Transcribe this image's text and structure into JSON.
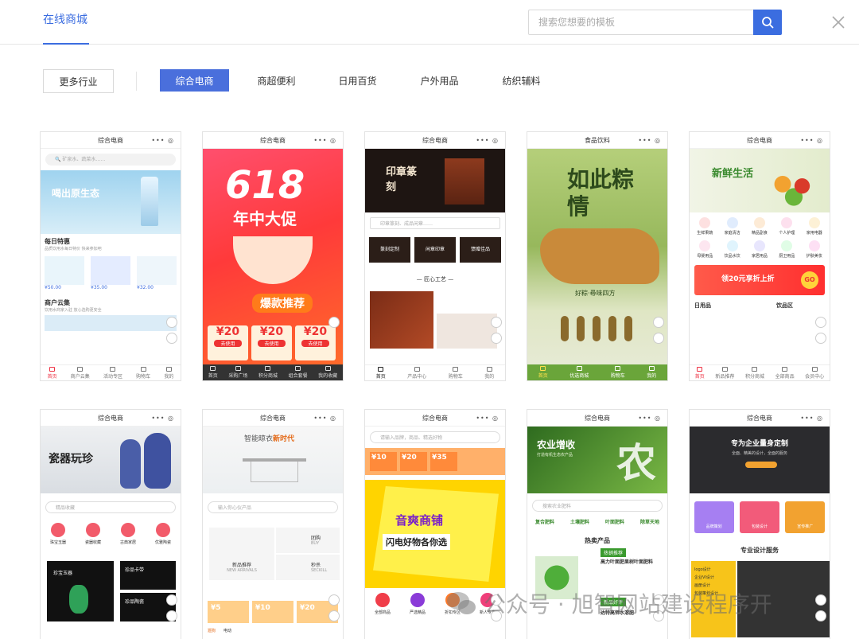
{
  "header": {
    "tab_label": "在线商城",
    "search_placeholder": "搜索您想要的模板"
  },
  "filters": {
    "more_label": "更多行业",
    "categories": [
      {
        "label": "综合电商",
        "active": true
      },
      {
        "label": "商超便利"
      },
      {
        "label": "日用百货"
      },
      {
        "label": "户外用品"
      },
      {
        "label": "纺织辅料"
      }
    ]
  },
  "templates": [
    {
      "title": "综合电商",
      "search": "矿泉水、蔬菜水……",
      "banner": "喝出原生态",
      "section1": "每日特惠",
      "section1_sub": "品质饮用水每日特价 快来参加吧",
      "prices": [
        "¥50.00",
        "¥35.00",
        "¥32.00"
      ],
      "section2": "商户云集",
      "section2_sub": "饮用水商家入驻 放心选购更安全",
      "tabs": [
        "首页",
        "商户云集",
        "活动专区",
        "购物车",
        "我的"
      ]
    },
    {
      "title": "综合电商",
      "banner_big": "618",
      "banner_sub": "年中大促",
      "banner_promo": "爆款推荐",
      "coupon_value": "20",
      "coupon_btn": "去使用",
      "tabs": [
        "首页",
        "采购广场",
        "积分商城",
        "组合套餐",
        "我的收藏"
      ]
    },
    {
      "title": "综合电商",
      "banner": "印章篆刻",
      "search": "印章篆刻、成品闲章……",
      "cats": [
        "篆刻定制",
        "闲章印章",
        "馈赠佳品"
      ],
      "section": "匠心工艺",
      "tabs": [
        "首页",
        "产品中心",
        "购物车",
        "我的"
      ]
    },
    {
      "title": "食品饮料",
      "banner": "如此粽情",
      "tagline": "好粽·尋味四方",
      "tabs": [
        "首页",
        "优选商城",
        "购物车",
        "我的"
      ]
    },
    {
      "title": "综合电商",
      "banner": "新鲜生活",
      "icons1": [
        "生鲜果蔬",
        "家庭清洁",
        "精品副食",
        "个人护理",
        "家用电器"
      ],
      "icons2": [
        "母婴用品",
        "饮品水饮",
        "家居用品",
        "厨卫用品",
        "护肤美妆"
      ],
      "coupon": "领20元享折上折",
      "section1": "日用品",
      "section2": "饮品区",
      "tabs": [
        "首页",
        "新品推荐",
        "积分商城",
        "全部商品",
        "会员中心"
      ]
    },
    {
      "title": "综合电商",
      "banner": "瓷器玩珍",
      "search": "精品收藏",
      "cats": [
        "珠宝玉器",
        "瓷器收藏",
        "古典家居",
        "优雅陶瓷"
      ],
      "product": "珍宝玉器",
      "product2": "珍品卡带",
      "product3": "珍品陶瓷"
    },
    {
      "title": "综合电商",
      "banner_pre": "智能晾衣",
      "banner_hl": "新时代",
      "search": "输入你心仪产品",
      "label1": "新品推荐",
      "label1_sub": "NEW ARRIVALS",
      "label2": "团购",
      "label2_sub": "BUY",
      "label3": "秒杀",
      "label3_sub": "SECKILL",
      "coupon_values": [
        "5",
        "10",
        "20"
      ],
      "tabs": [
        "遛狗",
        "电动"
      ]
    },
    {
      "title": "综合电商",
      "search": "请输入品牌，商品、精选好物",
      "coupon_values": [
        "10",
        "20",
        "35"
      ],
      "banner": "音爽商铺",
      "banner_sub": "闪电好物各你选",
      "icons": [
        "全部商品",
        "严选精品",
        "折扣专区",
        "新人专享"
      ]
    },
    {
      "title": "综合电商",
      "banner": "农业增收",
      "banner_sub": "打造有机生态农产品",
      "big_char": "农",
      "search": "搜索农业肥料",
      "cats": [
        "复合肥料",
        "土壤肥料",
        "叶面肥料",
        "除草天地"
      ],
      "section": "热卖产品",
      "tag": "热销推荐",
      "product": "高力叶面肥果树叶面肥料",
      "tag2": "新品好评",
      "product2": "达特高钾水溶肥"
    },
    {
      "title": "综合电商",
      "banner": "专为企业量身定制",
      "banner_sub": "全面、精美的设计，全面的服务",
      "cats": [
        "品牌策划",
        "包装设计",
        "宣传推广"
      ],
      "section": "专业设计服务",
      "list": [
        "logo设计",
        "企业VI设计",
        "画册设计",
        "包装策划设计"
      ]
    }
  ],
  "watermark": {
    "text": "公众号 · 旭智网站建设程序开"
  }
}
